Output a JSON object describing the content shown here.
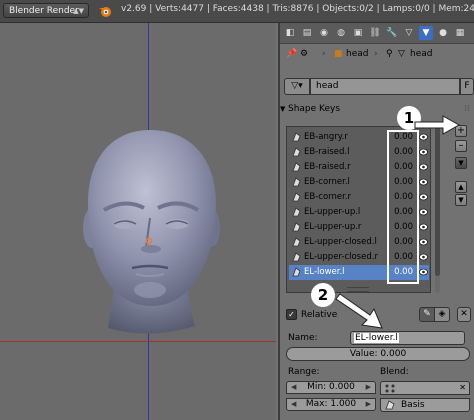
{
  "topbar": {
    "engine": "Blender Render",
    "stats": "v2.69 | Verts:4477 | Faces:4438 | Tris:8876 | Objects:0/2 | Lamps:0/0 | Mem:24.80M"
  },
  "panel": {
    "breadcrumb": {
      "mesh_name": "head",
      "data_name": "head"
    },
    "datablock": {
      "name": "head",
      "fake_user": "F"
    },
    "section_title": "Shape Keys",
    "shape_keys": [
      {
        "name": "EB-angry.r",
        "value": "0.00"
      },
      {
        "name": "EB-raised.l",
        "value": "0.00"
      },
      {
        "name": "EB-raised.r",
        "value": "0.00"
      },
      {
        "name": "EB-corner.l",
        "value": "0.00"
      },
      {
        "name": "EB-corner.r",
        "value": "0.00"
      },
      {
        "name": "EL-upper-up.l",
        "value": "0.00"
      },
      {
        "name": "EL-upper-up.r",
        "value": "0.00"
      },
      {
        "name": "EL-upper-closed.l",
        "value": "0.00"
      },
      {
        "name": "EL-upper-closed.r",
        "value": "0.00"
      },
      {
        "name": "EL-lower.l",
        "value": "0.00",
        "selected": true
      }
    ],
    "buttons": {
      "add": "+",
      "remove": "–",
      "special": "▼",
      "up": "▲",
      "down": "▼"
    },
    "relative_label": "Relative",
    "name_label": "Name:",
    "name_value": "EL-lower.l",
    "value_slider": "Value: 0.000",
    "range_label": "Range:",
    "min_value": "Min: 0.000",
    "max_value": "Max: 1.000",
    "blend_label": "Blend:",
    "blend_basis": "Basis"
  },
  "annotations": {
    "badge1": "1",
    "badge2": "2"
  },
  "colors": {
    "selection": "#5882c6",
    "active_tab": "#3b6ec4",
    "annotation": "#ffffff"
  }
}
